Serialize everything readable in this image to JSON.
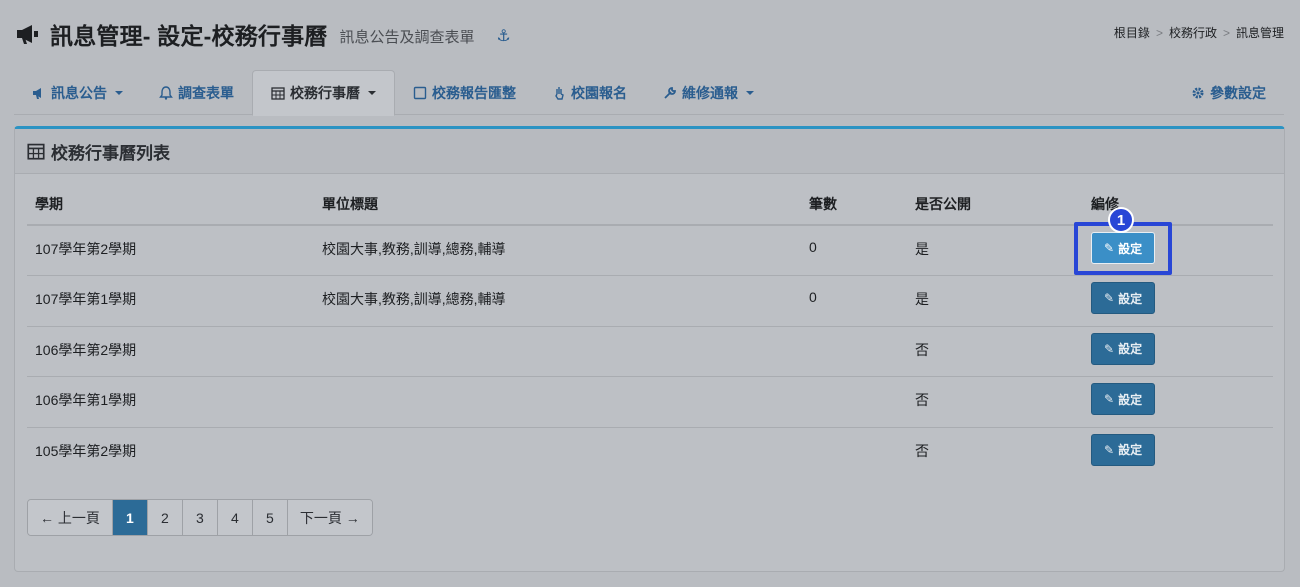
{
  "header": {
    "title": "訊息管理- 設定-校務行事曆",
    "subtitle": "訊息公告及調查表單",
    "anchor_icon": "anchor-icon"
  },
  "breadcrumb": [
    "根目錄",
    "校務行政",
    "訊息管理"
  ],
  "breadcrumb_sep": ">",
  "tabs": [
    {
      "label": "訊息公告",
      "icon": "megaphone-icon",
      "dropdown": true
    },
    {
      "label": "調查表單",
      "icon": "bell-icon",
      "dropdown": false
    },
    {
      "label": "校務行事曆",
      "icon": "calendar-icon",
      "dropdown": true,
      "active": true
    },
    {
      "label": "校務報告匯整",
      "icon": "square-icon",
      "dropdown": false
    },
    {
      "label": "校園報名",
      "icon": "hand-icon",
      "dropdown": false
    },
    {
      "label": "維修通報",
      "icon": "wrench-icon",
      "dropdown": true
    },
    {
      "label": "參數設定",
      "icon": "gear-icon",
      "dropdown": false
    }
  ],
  "panel": {
    "title": "校務行事曆列表"
  },
  "table": {
    "columns": [
      "學期",
      "單位標題",
      "筆數",
      "是否公開",
      "編修"
    ],
    "rows": [
      {
        "term": "107學年第2學期",
        "units": "校園大事,教務,訓導,總務,輔導",
        "count": "0",
        "public": "是",
        "action": "設定"
      },
      {
        "term": "107學年第1學期",
        "units": "校園大事,教務,訓導,總務,輔導",
        "count": "0",
        "public": "是",
        "action": "設定"
      },
      {
        "term": "106學年第2學期",
        "units": "",
        "count": "",
        "public": "否",
        "action": "設定"
      },
      {
        "term": "106學年第1學期",
        "units": "",
        "count": "",
        "public": "否",
        "action": "設定"
      },
      {
        "term": "105學年第2學期",
        "units": "",
        "count": "",
        "public": "否",
        "action": "設定"
      }
    ]
  },
  "step_badge": "1",
  "pagination": {
    "prev": "← 上一頁",
    "pages": [
      "1",
      "2",
      "3",
      "4",
      "5"
    ],
    "active_page": "1",
    "next": "下一頁 →"
  },
  "colors": {
    "accent": "#2c6b97",
    "panel_top": "#2b93c3",
    "highlight": "#2846d6"
  }
}
